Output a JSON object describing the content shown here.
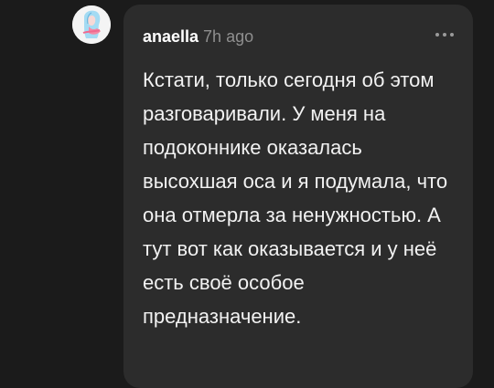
{
  "comment": {
    "author": "anaella",
    "time": "7h ago",
    "text": "Кстати, только сегодня об этом разговаривали. У меня на подоконнике оказалась высохшая оса и я подумала, что она отмерла за ненужностью. А тут вот как оказывается и у неё есть своё особое предназначение.",
    "avatar_icon": "user-avatar-drawing",
    "menu_icon": "more-dots-icon"
  }
}
